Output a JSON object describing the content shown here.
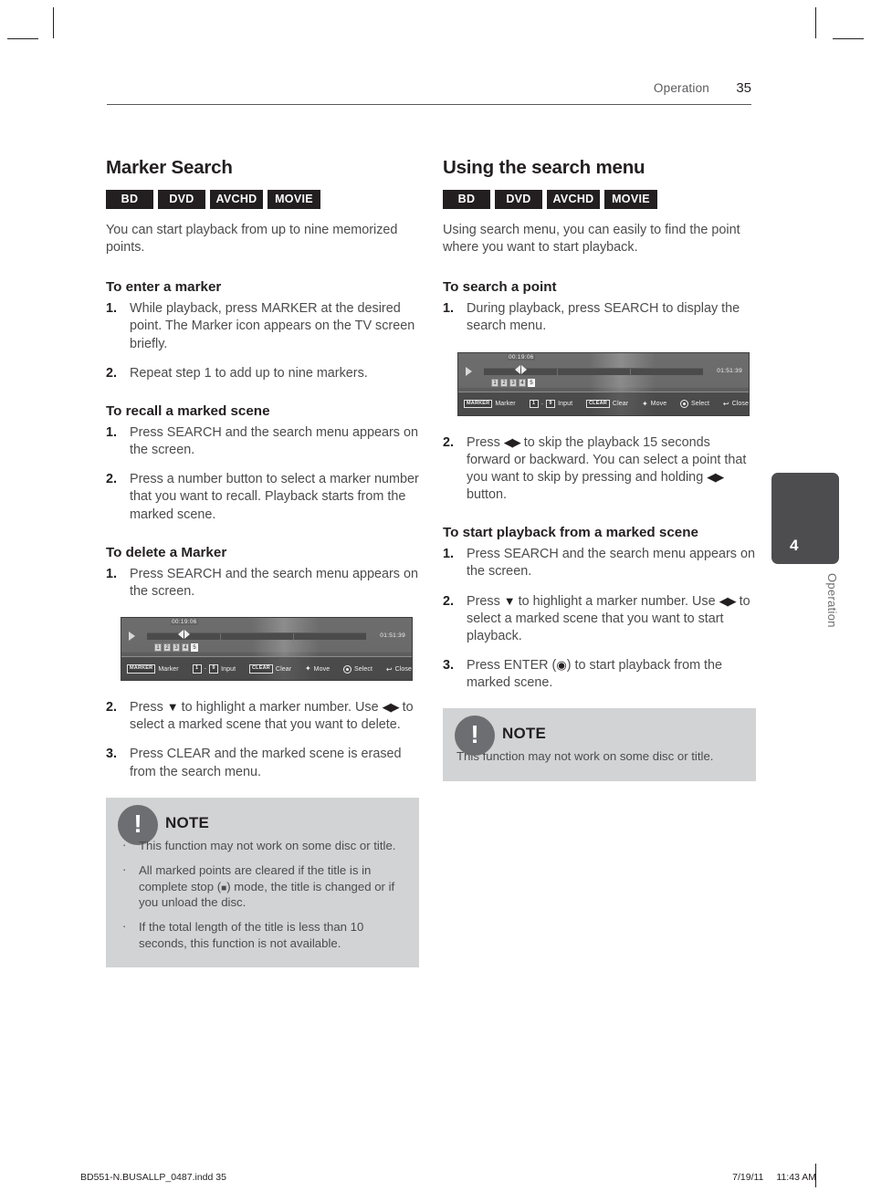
{
  "running_head": {
    "label": "Operation",
    "page": "35"
  },
  "side_tab": {
    "number": "4",
    "label": "Operation"
  },
  "left_column": {
    "section_title": "Marker Search",
    "badges": [
      "BD",
      "DVD",
      "AVCHD",
      "MOVIE"
    ],
    "lead": "You can start playback from up to nine memorized points.",
    "groups": [
      {
        "heading": "To enter a marker",
        "steps": [
          {
            "num": "1.",
            "text": "While playback, press MARKER at the desired point. The Marker icon appears on the TV screen briefly."
          },
          {
            "num": "2.",
            "text": "Repeat step 1 to add up to nine markers."
          }
        ]
      },
      {
        "heading": "To recall a marked scene",
        "steps": [
          {
            "num": "1.",
            "text": "Press SEARCH and the search menu appears on the screen."
          },
          {
            "num": "2.",
            "text": "Press a number button to select a marker number that you want to recall. Playback starts from the marked scene."
          }
        ]
      },
      {
        "heading": "To delete a Marker",
        "steps": [
          {
            "num": "1.",
            "text": "Press SEARCH and the search menu appears on the screen."
          }
        ]
      }
    ],
    "steps_after_figure": [
      {
        "num": "2.",
        "pre": "Press ",
        "glyph1": "▼",
        "mid": " to highlight a marker number. Use ",
        "glyph2": "◀▶",
        "post": " to select a marked scene that you want to delete."
      },
      {
        "num": "3.",
        "pre": "Press CLEAR and the marked scene is erased from the search menu.",
        "glyph1": "",
        "mid": "",
        "glyph2": "",
        "post": ""
      }
    ],
    "note": {
      "title": "NOTE",
      "items": [
        {
          "pre": "This function may not work on some disc or title.",
          "glyph": "",
          "post": ""
        },
        {
          "pre": "All marked points are cleared if the title is in complete stop (",
          "glyph": "■",
          "post": ") mode, the title is changed or if you unload the disc."
        },
        {
          "pre": "If the total length of the title is less than 10 seconds, this function is not available.",
          "glyph": "",
          "post": ""
        }
      ]
    }
  },
  "right_column": {
    "section_title": "Using the search menu",
    "badges": [
      "BD",
      "DVD",
      "AVCHD",
      "MOVIE"
    ],
    "lead": "Using search menu, you can easily to find the point where you want to start playback.",
    "group_search": {
      "heading": "To search a point",
      "step1": {
        "num": "1.",
        "text": "During playback, press SEARCH to display the search menu."
      },
      "step2": {
        "num": "2.",
        "pre": "Press ",
        "glyph1": "◀▶",
        "mid": " to skip the playback 15 seconds forward or backward. You can select a point that you want to skip by pressing and holding ",
        "glyph2": "◀▶",
        "post": " button."
      }
    },
    "group_start": {
      "heading": "To start playback from a marked scene",
      "step1": {
        "num": "1.",
        "text": "Press SEARCH and the search menu appears on the screen."
      },
      "step2": {
        "num": "2.",
        "pre": "Press ",
        "glyph1": "▼",
        "mid": " to highlight a marker number. Use ",
        "glyph2": "◀▶",
        "post": " to select a marked scene that you want to start playback."
      },
      "step3": {
        "num": "3.",
        "pre": "Press ENTER (",
        "glyph1": "◉",
        "post": ") to start playback from the marked scene."
      }
    },
    "note": {
      "title": "NOTE",
      "text": "This function may not work on some disc or title."
    }
  },
  "osd": {
    "current_time": "00:19:06",
    "total_time": "01:51:39",
    "markers": [
      "1",
      "2",
      "3",
      "4",
      "5"
    ],
    "selected_marker": "5",
    "legend": [
      {
        "key": "MARKER",
        "label": "Marker"
      },
      {
        "key_from": "1",
        "key_to": "9",
        "label": "Input"
      },
      {
        "key": "CLEAR",
        "label": "Clear"
      },
      {
        "icon": "dpad-icon",
        "label": "Move"
      },
      {
        "icon": "enter-circle-icon",
        "label": "Select"
      },
      {
        "icon": "return-icon",
        "label": "Close"
      }
    ]
  },
  "footer": {
    "file": "BD551-N.BUSALLP_0487.indd   35",
    "date": "7/19/11",
    "time": "11:43 AM"
  }
}
